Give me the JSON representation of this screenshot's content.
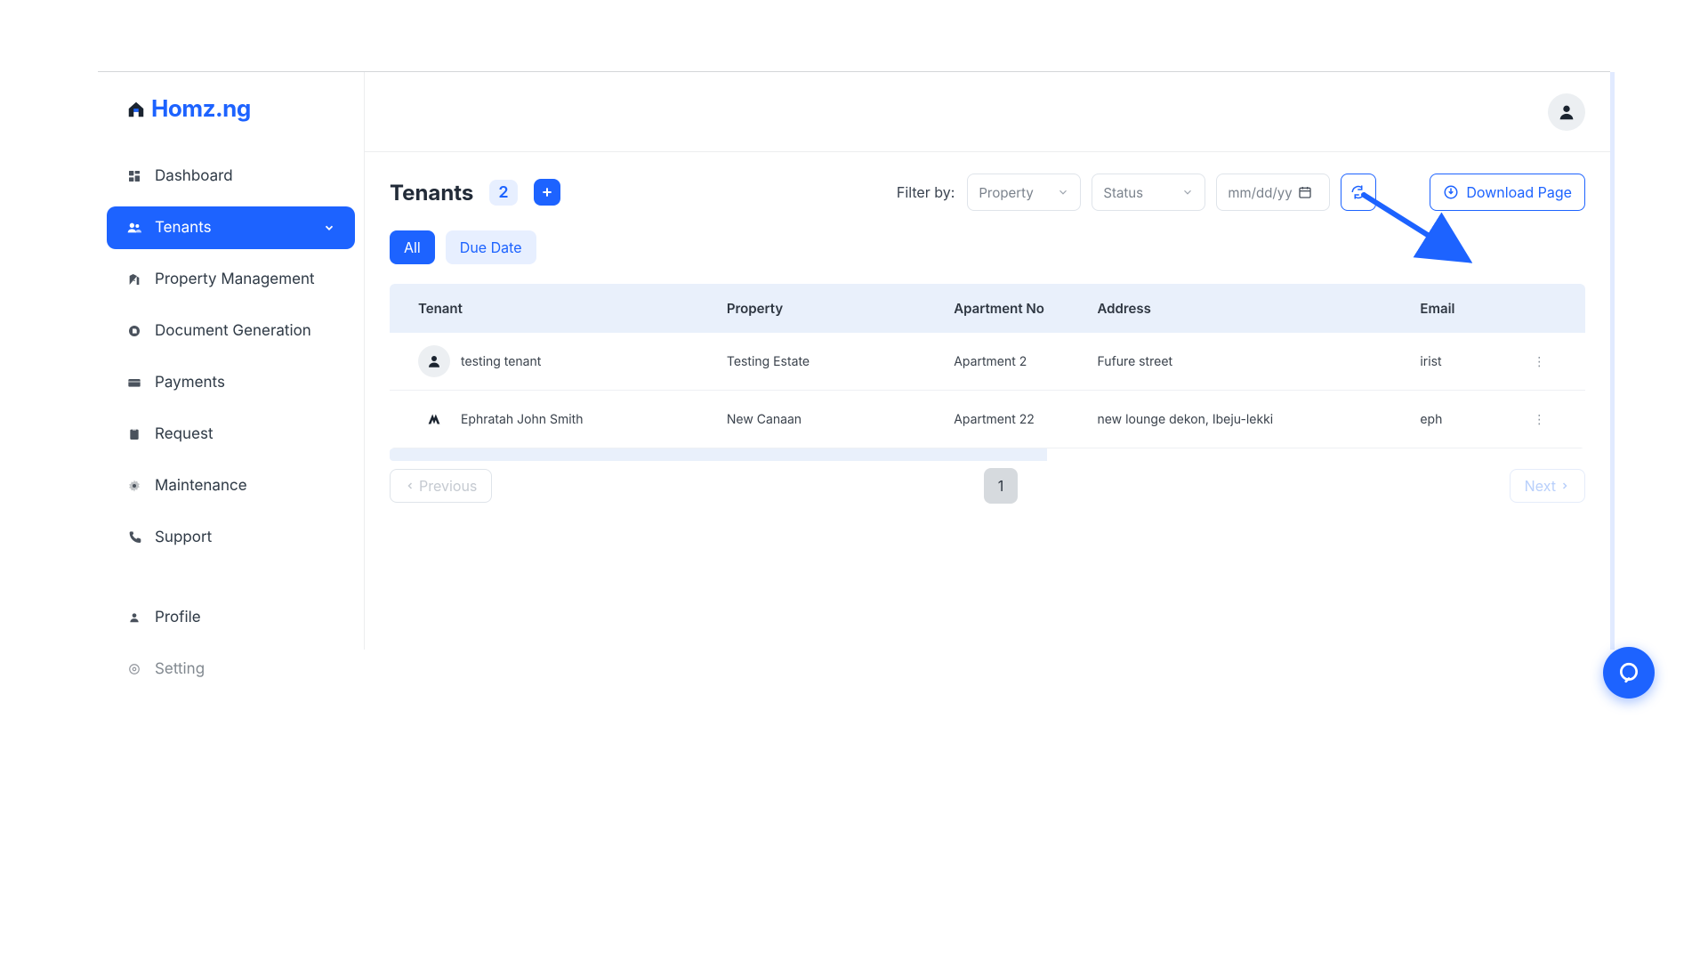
{
  "brand": {
    "name": "Homz.ng"
  },
  "sidebar": {
    "items": [
      {
        "label": "Dashboard",
        "icon": "grid"
      },
      {
        "label": "Tenants",
        "icon": "users",
        "active": true,
        "chevron": true
      },
      {
        "label": "Property Management",
        "icon": "building"
      },
      {
        "label": "Document Generation",
        "icon": "doc"
      },
      {
        "label": "Payments",
        "icon": "card"
      },
      {
        "label": "Request",
        "icon": "clipboard"
      },
      {
        "label": "Maintenance",
        "icon": "gear"
      },
      {
        "label": "Support",
        "icon": "phone"
      }
    ],
    "secondary": [
      {
        "label": "Profile",
        "icon": "person"
      },
      {
        "label": "Setting",
        "icon": "cog"
      }
    ]
  },
  "header": {
    "title": "Tenants",
    "count": "2",
    "filter_label": "Filter by:",
    "property_placeholder": "Property",
    "status_placeholder": "Status",
    "date_placeholder": "mm/dd/yy",
    "download_label": "Download Page"
  },
  "tabs": {
    "all": "All",
    "due": "Due Date"
  },
  "table": {
    "columns": [
      "Tenant",
      "Property",
      "Apartment No",
      "Address",
      "Email"
    ],
    "rows": [
      {
        "tenant": "testing tenant",
        "avatar": "generic",
        "property": "Testing Estate",
        "apartment": "Apartment 2",
        "address": "Fufure street",
        "email": "irist"
      },
      {
        "tenant": "Ephratah John Smith",
        "avatar": "logo",
        "property": "New Canaan",
        "apartment": "Apartment 22",
        "address": "new lounge dekon, Ibeju-lekki",
        "email": "eph"
      }
    ]
  },
  "pagination": {
    "prev": "Previous",
    "next": "Next",
    "current": "1"
  }
}
